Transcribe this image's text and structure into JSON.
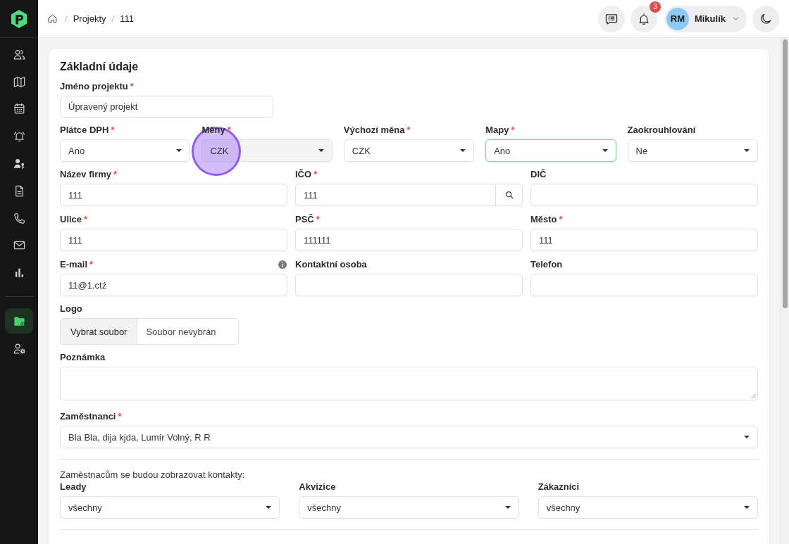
{
  "sidebar": {
    "groups": [
      {
        "items": [
          {
            "selected": false
          },
          {
            "selected": false
          },
          {
            "selected": false
          },
          {
            "selected": false
          },
          {
            "selected": false
          },
          {
            "selected": false
          },
          {
            "selected": false
          },
          {
            "selected": false
          },
          {
            "selected": false
          }
        ]
      },
      {
        "items": [
          {
            "selected": true
          },
          {
            "selected": false
          }
        ]
      }
    ]
  },
  "topbar": {
    "breadcrumb": [
      {
        "separator": "/",
        "label": "Projekty"
      },
      {
        "separator": "/",
        "label": "111"
      }
    ],
    "notifications": {
      "badge": "3"
    },
    "user": {
      "initials": "RM",
      "name": "Mikulík"
    }
  },
  "form": {
    "title": "Základní údaje",
    "project_name": {
      "label": "Jméno projektu",
      "required_mark": "*",
      "value": "Úpravený projekt"
    },
    "settings": [
      {
        "label": "Plátce DPH",
        "required_mark": "*",
        "value": "Ano",
        "focused": false,
        "clicked": false
      },
      {
        "label": "Měny",
        "required_mark": "*",
        "value": "CZK",
        "focused": false,
        "clicked": true
      },
      {
        "label": "Výchozí měna",
        "required_mark": "*",
        "value": "CZK",
        "focused": false,
        "clicked": false
      },
      {
        "label": "Mapy",
        "required_mark": "*",
        "value": "Ano",
        "focused": true,
        "clicked": false
      },
      {
        "label": "Zaokrouhlování",
        "value": "Ne",
        "focused": false,
        "clicked": false
      }
    ],
    "company": [
      [
        {
          "kind": "text",
          "label": "Název firmy",
          "required_mark": "*",
          "value": "111",
          "info": false
        },
        {
          "kind": "search",
          "label": "IČO",
          "required_mark": "*",
          "value": "111",
          "info": false
        },
        {
          "kind": "text",
          "label": "DIČ",
          "info": false
        }
      ],
      [
        {
          "kind": "text",
          "label": "Ulice",
          "required_mark": "*",
          "value": "111",
          "info": false
        },
        {
          "kind": "text",
          "label": "PSČ",
          "required_mark": "*",
          "value": "111111",
          "info": false
        },
        {
          "kind": "text",
          "label": "Město",
          "required_mark": "*",
          "value": "111",
          "info": false
        }
      ],
      [
        {
          "kind": "text",
          "label": "E-mail",
          "required_mark": "*",
          "value": "11@1.ctź",
          "info": true
        },
        {
          "kind": "text",
          "label": "Kontaktní osoba",
          "info": false
        },
        {
          "kind": "text",
          "label": "Telefon",
          "info": false
        }
      ]
    ],
    "logo": {
      "label": "Logo",
      "button": "Vybrat soubor",
      "status": "Soubor nevybrán"
    },
    "note": {
      "label": "Poznámka"
    },
    "employees": {
      "label": "Zaměstnanci",
      "required_mark": "*",
      "value": "Bla Bla, dija kjda, Lumír Volný, R R"
    },
    "contact_visibility": {
      "caption": "Zaměstnacům se budou zobrazovat kontakty:",
      "fields": [
        {
          "label": "Leady",
          "value": "všechny"
        },
        {
          "label": "Akvizice",
          "value": "všechny"
        },
        {
          "label": "Zákazníci",
          "value": "všechny"
        }
      ]
    }
  }
}
